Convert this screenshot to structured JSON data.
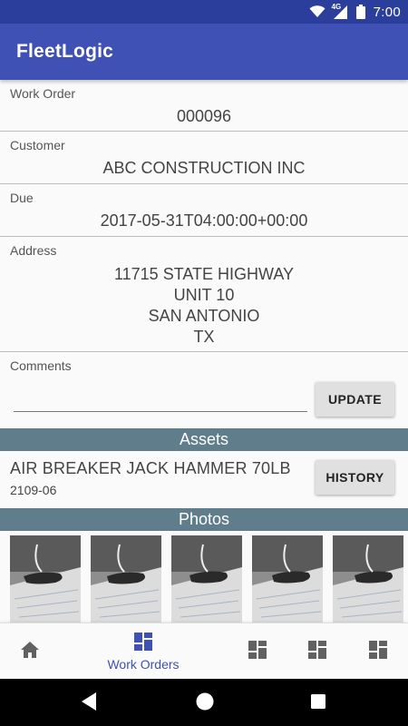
{
  "status_bar": {
    "time": "7:00",
    "network": "4G"
  },
  "app": {
    "title": "FleetLogic"
  },
  "work_order": {
    "label": "Work Order",
    "value": "000096"
  },
  "customer": {
    "label": "Customer",
    "value": "ABC CONSTRUCTION INC"
  },
  "due": {
    "label": "Due",
    "value": "2017-05-31T04:00:00+00:00"
  },
  "address": {
    "label": "Address",
    "lines": [
      "11715 STATE HIGHWAY",
      "UNIT 10",
      "SAN ANTONIO",
      "TX"
    ]
  },
  "comments": {
    "label": "Comments",
    "value": "",
    "update_label": "UPDATE"
  },
  "assets": {
    "header": "Assets",
    "items": [
      {
        "name": "AIR BREAKER JACK HAMMER 70LB",
        "code": "2109-06",
        "history_label": "HISTORY"
      }
    ]
  },
  "photos": {
    "header": "Photos",
    "count_visible": 5
  },
  "bottom_nav": {
    "items": [
      {
        "icon": "home-icon",
        "label": ""
      },
      {
        "icon": "dashboard-icon",
        "label": "Work Orders",
        "active": true
      },
      {
        "icon": "dashboard-icon",
        "label": ""
      },
      {
        "icon": "dashboard-icon",
        "label": ""
      },
      {
        "icon": "dashboard-icon",
        "label": ""
      }
    ]
  },
  "colors": {
    "status_bar": "#2b3e9c",
    "app_bar": "#3f51b5",
    "section_header": "#607d8b",
    "nav_active": "#3f51b5",
    "nav_inactive": "#616161"
  }
}
